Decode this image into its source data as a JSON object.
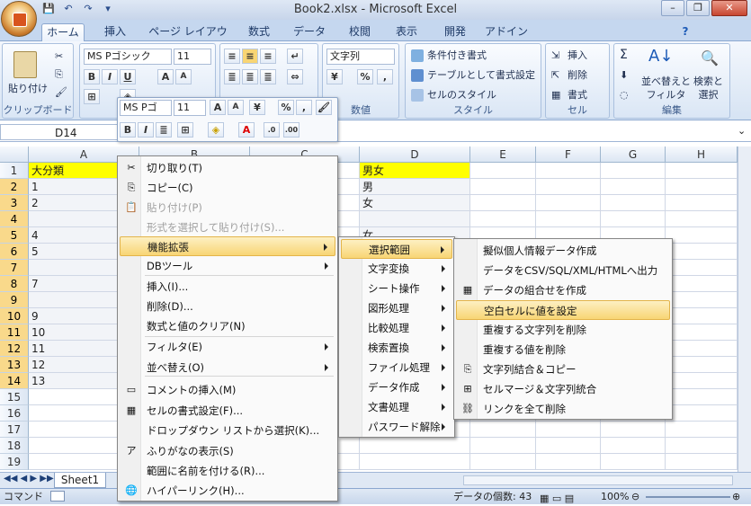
{
  "window": {
    "title": "Book2.xlsx - Microsoft Excel",
    "minimize": "–",
    "restore": "❐",
    "close": "✕"
  },
  "qat": [
    "💾",
    "↶",
    "↷",
    "▾"
  ],
  "tabs": [
    "ホーム",
    "挿入",
    "ページ レイアウト",
    "数式",
    "データ",
    "校閲",
    "表示",
    "開発",
    "アドイン"
  ],
  "ribbon": {
    "clipboard": {
      "paste": "貼り付け",
      "label": "クリップボード"
    },
    "font": {
      "name": "MS Pゴシック",
      "size": "11",
      "bold": "B",
      "italic": "I",
      "underline": "U",
      "grow": "A",
      "shrink": "A"
    },
    "number": {
      "format": "文字列",
      "label": "数値",
      "percent": "%",
      "comma": ","
    },
    "styles": {
      "conditional": "条件付き書式",
      "table": "テーブルとして書式設定",
      "cell": "セルのスタイル",
      "label": "スタイル"
    },
    "cells": {
      "insert": "挿入",
      "delete": "削除",
      "format": "書式",
      "label": "セル"
    },
    "editing": {
      "sum": "Σ",
      "sort": "並べ替えと\nフィルタ",
      "find": "検索と\n選択",
      "label": "編集"
    }
  },
  "mini_toolbar": {
    "font": "MS Pゴ",
    "size": "11",
    "bold": "B",
    "italic": "I",
    "percent": "%",
    "comma": ","
  },
  "formula": {
    "namebox": "D14"
  },
  "columns": [
    "A",
    "B",
    "C",
    "D",
    "E",
    "F",
    "G",
    "H"
  ],
  "rows": [
    {
      "n": "1",
      "a": "大分類",
      "d": "男女"
    },
    {
      "n": "2",
      "a": "1",
      "d": "男"
    },
    {
      "n": "3",
      "a": "2",
      "d": "女"
    },
    {
      "n": "4",
      "a": "",
      "d": ""
    },
    {
      "n": "5",
      "a": "4",
      "d": "女"
    },
    {
      "n": "6",
      "a": "5",
      "d": ""
    },
    {
      "n": "7",
      "a": "",
      "d": ""
    },
    {
      "n": "8",
      "a": "7",
      "d": ""
    },
    {
      "n": "9",
      "a": "",
      "d": ""
    },
    {
      "n": "10",
      "a": "9",
      "d": ""
    },
    {
      "n": "11",
      "a": "10",
      "d": ""
    },
    {
      "n": "12",
      "a": "11",
      "d": ""
    },
    {
      "n": "13",
      "a": "12",
      "d": ""
    },
    {
      "n": "14",
      "a": "13",
      "d": ""
    },
    {
      "n": "15",
      "a": "",
      "d": ""
    },
    {
      "n": "16",
      "a": "",
      "d": ""
    },
    {
      "n": "17",
      "a": "",
      "d": ""
    },
    {
      "n": "18",
      "a": "",
      "d": ""
    },
    {
      "n": "19",
      "a": "",
      "d": ""
    }
  ],
  "context_menu": [
    {
      "label": "切り取り(T)",
      "icon": "✂"
    },
    {
      "label": "コピー(C)",
      "icon": "⎘"
    },
    {
      "label": "貼り付け(P)",
      "icon": "📋",
      "disabled": true
    },
    {
      "label": "形式を選択して貼り付け(S)...",
      "disabled": true
    },
    {
      "label": "機能拡張",
      "sub": true,
      "highlight": true
    },
    {
      "label": "DBツール",
      "sub": true
    },
    {
      "label": "挿入(I)..."
    },
    {
      "label": "削除(D)..."
    },
    {
      "label": "数式と値のクリア(N)"
    },
    {
      "label": "フィルタ(E)",
      "sub": true
    },
    {
      "label": "並べ替え(O)",
      "sub": true
    },
    {
      "label": "コメントの挿入(M)",
      "icon": "▭"
    },
    {
      "label": "セルの書式設定(F)...",
      "icon": "▦"
    },
    {
      "label": "ドロップダウン リストから選択(K)..."
    },
    {
      "label": "ふりがなの表示(S)",
      "icon": "ア"
    },
    {
      "label": "範囲に名前を付ける(R)..."
    },
    {
      "label": "ハイパーリンク(H)...",
      "icon": "🌐"
    }
  ],
  "submenu1": [
    "選択範囲",
    "文字変換",
    "シート操作",
    "図形処理",
    "比較処理",
    "検索置換",
    "ファイル処理",
    "データ作成",
    "文書処理",
    "パスワード解除"
  ],
  "submenu2": [
    {
      "label": "擬似個人情報データ作成"
    },
    {
      "label": "データをCSV/SQL/XML/HTMLへ出力"
    },
    {
      "label": "データの組合せを作成",
      "icon": "▦"
    },
    {
      "label": "空白セルに値を設定",
      "highlight": true
    },
    {
      "label": "重複する文字列を削除"
    },
    {
      "label": "重複する値を削除"
    },
    {
      "label": "文字列結合＆コピー",
      "icon": "⎘"
    },
    {
      "label": "セルマージ＆文字列統合",
      "icon": "⊞"
    },
    {
      "label": "リンクを全て削除",
      "icon": "⛓"
    }
  ],
  "sheet": {
    "tab": "Sheet1"
  },
  "status": {
    "mode": "コマンド",
    "count": "データの個数: 43",
    "zoom": "100%"
  }
}
